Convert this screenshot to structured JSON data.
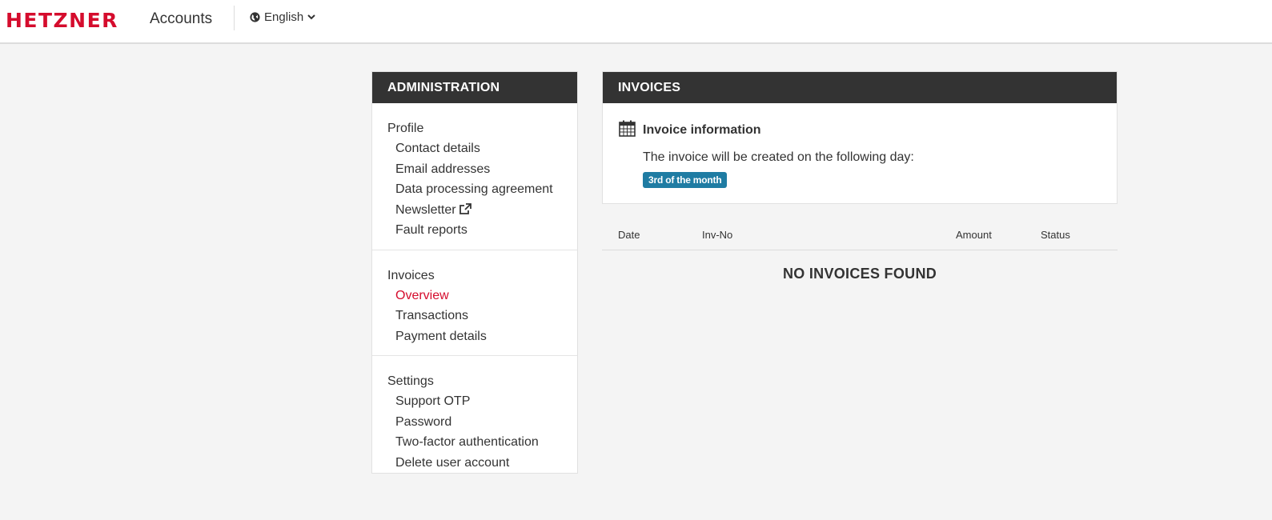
{
  "header": {
    "logo_text": "HETZNER",
    "app_name": "Accounts",
    "language": "English",
    "brand_color": "#d50c2d"
  },
  "sidebar": {
    "title": "ADMINISTRATION",
    "sections": [
      {
        "heading": "Profile",
        "items": [
          "Contact details",
          "Email addresses",
          "Data processing agreement",
          "Newsletter",
          "Fault reports"
        ]
      },
      {
        "heading": "Invoices",
        "items": [
          "Overview",
          "Transactions",
          "Payment details"
        ],
        "active": "Overview"
      },
      {
        "heading": "Settings",
        "items": [
          "Support OTP",
          "Password",
          "Two-factor authentication",
          "Delete user account"
        ]
      }
    ]
  },
  "main": {
    "title": "INVOICES",
    "info_title": "Invoice information",
    "info_text": "The invoice will be created on the following day:",
    "badge": "3rd of the month",
    "badge_color": "#1f7ca3"
  },
  "table": {
    "columns": [
      "Date",
      "Inv-No",
      "Amount",
      "Status"
    ],
    "empty_message": "NO INVOICES FOUND"
  }
}
